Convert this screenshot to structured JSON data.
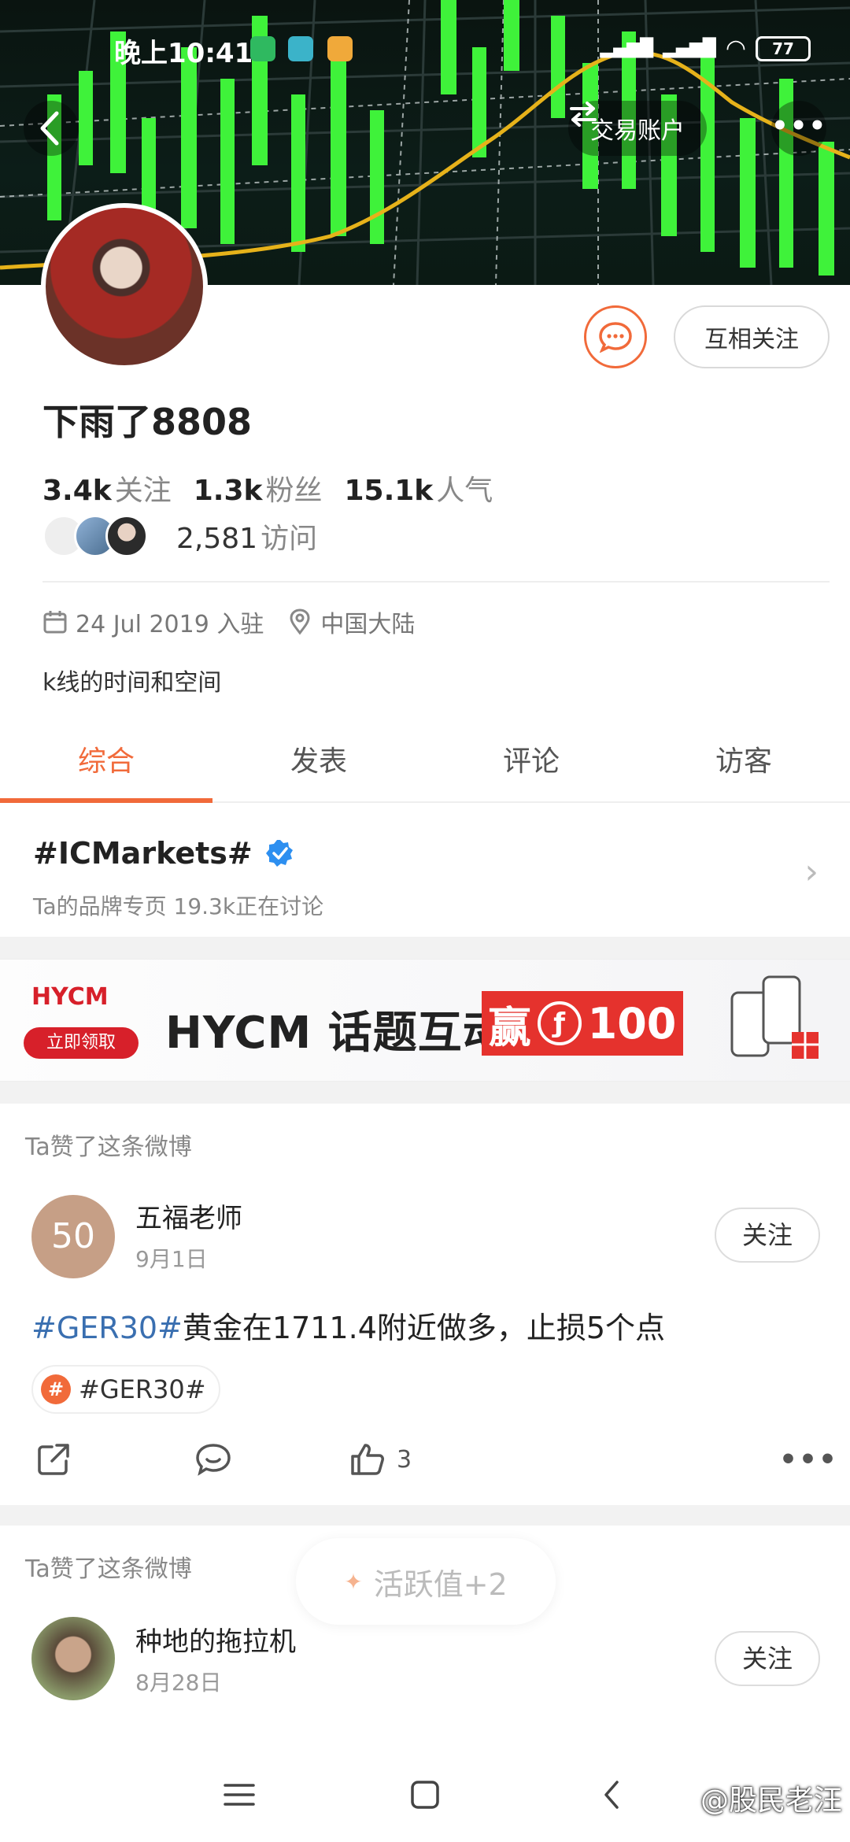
{
  "status_bar": {
    "time": "晚上10:41",
    "battery": "77"
  },
  "header": {
    "account_label": "交易账户"
  },
  "profile": {
    "username": "下雨了8808",
    "mutual_follow_label": "互相关注",
    "stats": [
      {
        "num": "3.4k",
        "label": "关注"
      },
      {
        "num": "1.3k",
        "label": "粉丝"
      },
      {
        "num": "15.1k",
        "label": "人气"
      }
    ],
    "visits_num": "2,581",
    "visits_label": "访问",
    "join_date": "24 Jul 2019 入驻",
    "location": "中国大陆",
    "bio": "k线的时间和空间"
  },
  "tabs": [
    "综合",
    "发表",
    "评论",
    "访客"
  ],
  "brand": {
    "title": "#ICMarkets#",
    "subtitle": "Ta的品牌专页  19.3k正在讨论"
  },
  "ad": {
    "logo": "HYCM",
    "button": "立即领取",
    "text": "HYCM 话题互动",
    "badge_prefix": "赢",
    "badge_value": "100"
  },
  "posts": [
    {
      "label": "Ta赞了这条微博",
      "avatar_text": "50",
      "name": "五福老师",
      "date": "9月1日",
      "follow": "关注",
      "hashtag": "#GER30#",
      "text": "黄金在1711.4附近做多，止损5个点",
      "tag": "#GER30#",
      "likes": "3"
    },
    {
      "label": "Ta赞了这条微博",
      "name": "种地的拖拉机",
      "date": "8月28日",
      "follow": "关注"
    }
  ],
  "toast": "活跃值+2",
  "watermark": "@股民老汪",
  "colors": {
    "accent": "#f16a3a",
    "hashtag": "#3a6fb0",
    "chart_green": "#3ff23a"
  }
}
